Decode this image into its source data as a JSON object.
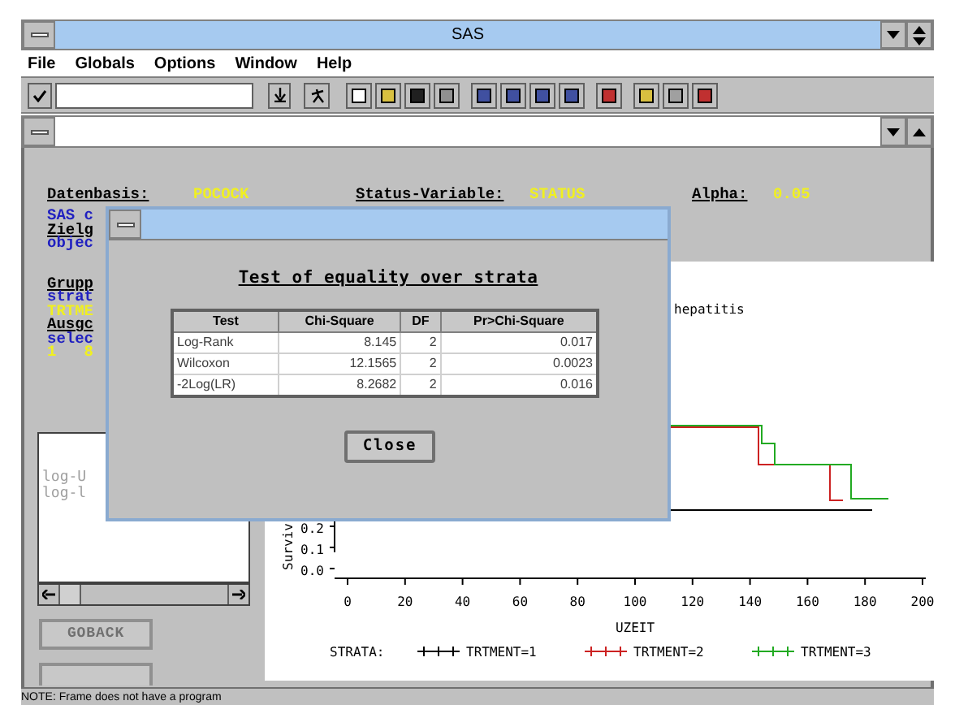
{
  "app_title": "SAS",
  "menu": [
    "File",
    "Globals",
    "Options",
    "Window",
    "Help"
  ],
  "header": {
    "datenbasis_label": "Datenbasis:",
    "datenbasis_value": "POCOCK",
    "status_label": "Status-Variable:",
    "status_value": "STATUS",
    "alpha_label": "Alpha:",
    "alpha_value": "0.05"
  },
  "left_lines": [
    {
      "text": "SAS c",
      "kind": "info"
    },
    {
      "text": "Zielg",
      "kind": "heading"
    },
    {
      "text": "objec",
      "kind": "info"
    },
    {
      "text": "Grupp",
      "kind": "heading"
    },
    {
      "text": "strat",
      "kind": "info"
    },
    {
      "text": "TRTME",
      "kind": "value"
    },
    {
      "text": "Ausgc",
      "kind": "heading"
    },
    {
      "text": "selec",
      "kind": "info"
    },
    {
      "text": "1   8",
      "kind": "value"
    }
  ],
  "list": {
    "items": [
      "log-U",
      "log-l"
    ]
  },
  "buttons": [
    "GOBACK"
  ],
  "chart": {
    "title": "hepatitis",
    "ylabel": "Surviv",
    "yticks": [
      "0.2",
      "0.1",
      "0.0"
    ],
    "xticks": [
      "0",
      "20",
      "40",
      "60",
      "80",
      "100",
      "120",
      "140",
      "160",
      "180",
      "200"
    ],
    "xlabel": "UZEIT",
    "legend_title": "STRATA:",
    "strata": [
      {
        "label": "TRTMENT=1",
        "color": "#000000"
      },
      {
        "label": "TRTMENT=2",
        "color": "#cc2222"
      },
      {
        "label": "TRTMENT=3",
        "color": "#22aa22"
      }
    ]
  },
  "dialog": {
    "heading": "Test of equality over strata",
    "columns": [
      "Test",
      "Chi-Square",
      "DF",
      "Pr>Chi-Square"
    ],
    "rows": [
      [
        "Log-Rank",
        "8.145",
        "2",
        "0.017"
      ],
      [
        "Wilcoxon",
        "12.1565",
        "2",
        "0.0023"
      ],
      [
        "-2Log(LR)",
        "8.2682",
        "2",
        "0.016"
      ]
    ],
    "close": "Close"
  },
  "status_bar": "NOTE: Frame does not have a program"
}
